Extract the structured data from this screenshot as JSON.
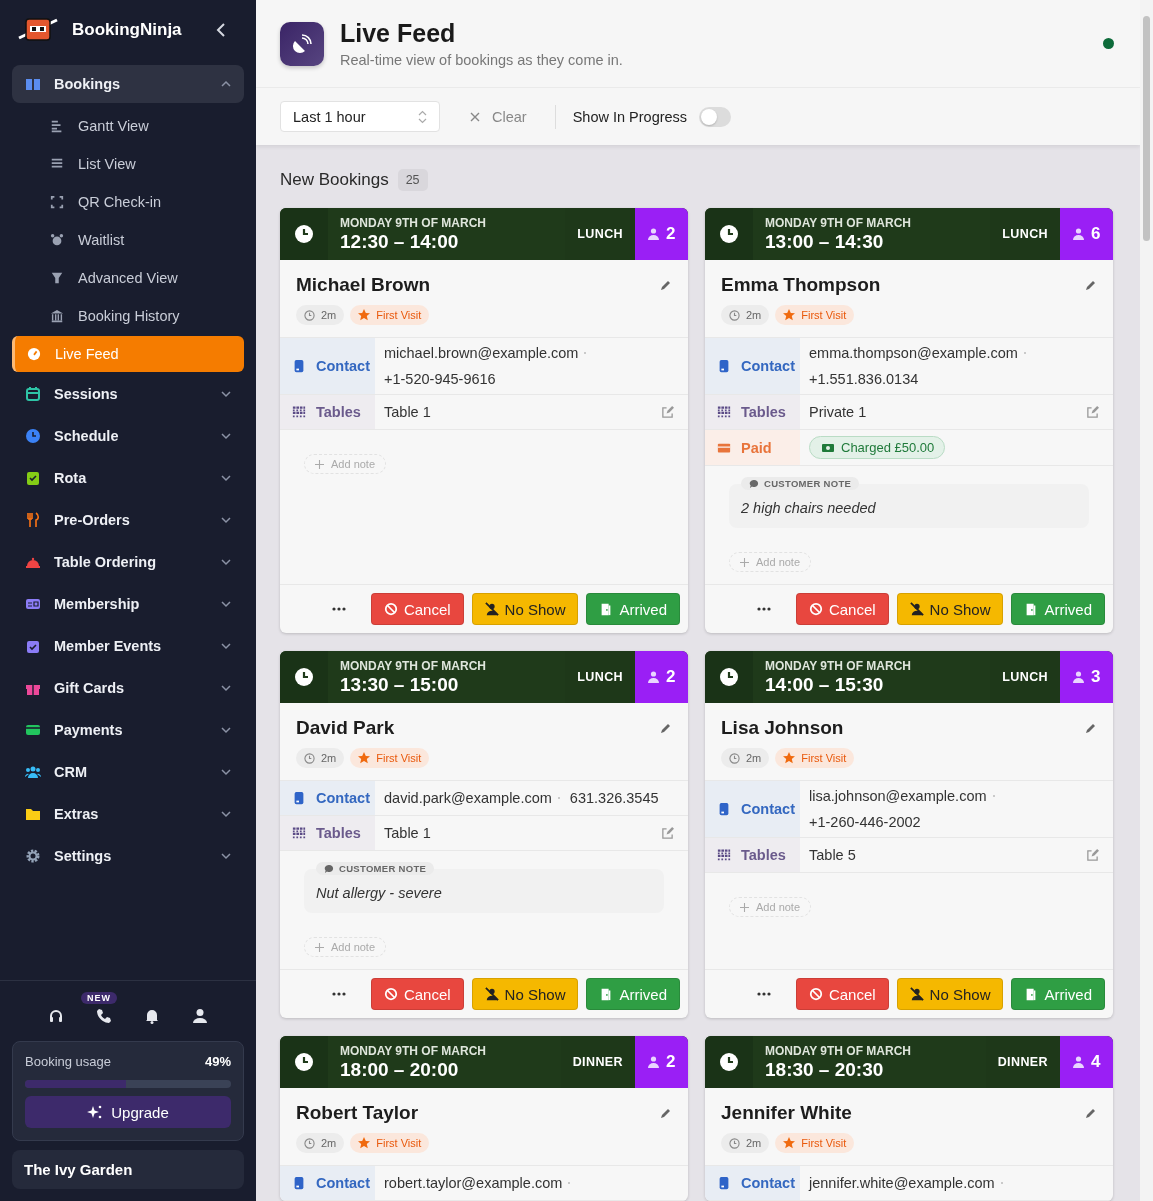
{
  "sidebar": {
    "brand": "BookingNinja",
    "nav": [
      {
        "label": "Bookings",
        "expanded": true,
        "children": [
          {
            "label": "Gantt View",
            "selected": false
          },
          {
            "label": "List View",
            "selected": false
          },
          {
            "label": "QR Check-in",
            "selected": false
          },
          {
            "label": "Waitlist",
            "selected": false
          },
          {
            "label": "Advanced View",
            "selected": false
          },
          {
            "label": "Booking History",
            "selected": false
          },
          {
            "label": "Live Feed",
            "selected": true
          }
        ]
      },
      {
        "label": "Sessions",
        "expanded": false
      },
      {
        "label": "Schedule",
        "expanded": false
      },
      {
        "label": "Rota",
        "expanded": false
      },
      {
        "label": "Pre-Orders",
        "expanded": false
      },
      {
        "label": "Table Ordering",
        "expanded": false
      },
      {
        "label": "Membership",
        "expanded": false
      },
      {
        "label": "Member Events",
        "expanded": false
      },
      {
        "label": "Gift Cards",
        "expanded": false
      },
      {
        "label": "Payments",
        "expanded": false
      },
      {
        "label": "CRM",
        "expanded": false
      },
      {
        "label": "Extras",
        "expanded": false
      },
      {
        "label": "Settings",
        "expanded": false
      }
    ],
    "new_badge": "NEW",
    "usage": {
      "label": "Booking usage",
      "value": "49%",
      "level": 0.49,
      "button": "Upgrade"
    },
    "venue": "The Ivy Garden"
  },
  "header": {
    "title": "Live Feed",
    "subtitle": "Real-time view of bookings as they come in.",
    "live": true
  },
  "filters": {
    "range": "Last 1 hour",
    "clear": "Clear",
    "show_in_progress": {
      "label": "Show In Progress",
      "on": false
    }
  },
  "section": {
    "title": "New Bookings",
    "count": "25"
  },
  "bookings": [
    {
      "date": "MONDAY 9TH OF MARCH",
      "time": "12:30 – 14:00",
      "service": "LUNCH",
      "guests": "2",
      "name": "Michael Brown",
      "age": "2m",
      "tag": "First Visit",
      "details": [
        {
          "kind": "contact",
          "label": "Contact",
          "values": [
            "michael.brown@example.com",
            "+1-520-945-9616"
          ]
        },
        {
          "kind": "tables",
          "label": "Tables",
          "values": [
            "Table 1"
          ]
        }
      ],
      "add_note": "Add note",
      "actions": [
        {
          "kind": "cancel",
          "label": "Cancel"
        },
        {
          "kind": "no_show",
          "label": "No Show"
        },
        {
          "kind": "arrived",
          "label": "Arrived"
        }
      ]
    },
    {
      "date": "MONDAY 9TH OF MARCH",
      "time": "13:00 – 14:30",
      "service": "LUNCH",
      "guests": "6",
      "name": "Emma Thompson",
      "age": "2m",
      "tag": "First Visit",
      "details": [
        {
          "kind": "contact",
          "label": "Contact",
          "values": [
            "emma.thompson@example.com",
            "+1.551.836.0134"
          ]
        },
        {
          "kind": "tables",
          "label": "Tables",
          "values": [
            "Private 1"
          ]
        },
        {
          "kind": "payment",
          "label": "Paid",
          "values": [
            "Charged £50.00"
          ]
        }
      ],
      "note": {
        "label": "CUSTOMER NOTE",
        "text": "2 high chairs needed"
      },
      "add_note": "Add note",
      "actions": [
        {
          "kind": "cancel",
          "label": "Cancel"
        },
        {
          "kind": "no_show",
          "label": "No Show"
        },
        {
          "kind": "arrived",
          "label": "Arrived"
        }
      ]
    },
    {
      "date": "MONDAY 9TH OF MARCH",
      "time": "13:30 – 15:00",
      "service": "LUNCH",
      "guests": "2",
      "name": "David Park",
      "age": "2m",
      "tag": "First Visit",
      "details": [
        {
          "kind": "contact",
          "label": "Contact",
          "values": [
            "david.park@example.com",
            "631.326.3545"
          ]
        },
        {
          "kind": "tables",
          "label": "Tables",
          "values": [
            "Table 1"
          ]
        }
      ],
      "note": {
        "label": "CUSTOMER NOTE",
        "text": "Nut allergy - severe"
      },
      "add_note": "Add note",
      "actions": [
        {
          "kind": "cancel",
          "label": "Cancel"
        },
        {
          "kind": "no_show",
          "label": "No Show"
        },
        {
          "kind": "arrived",
          "label": "Arrived"
        }
      ]
    },
    {
      "date": "MONDAY 9TH OF MARCH",
      "time": "14:00 – 15:30",
      "service": "LUNCH",
      "guests": "3",
      "name": "Lisa Johnson",
      "age": "2m",
      "tag": "First Visit",
      "details": [
        {
          "kind": "contact",
          "label": "Contact",
          "values": [
            "lisa.johnson@example.com",
            "+1-260-446-2002"
          ]
        },
        {
          "kind": "tables",
          "label": "Tables",
          "values": [
            "Table 5"
          ]
        }
      ],
      "add_note": "Add note",
      "actions": [
        {
          "kind": "cancel",
          "label": "Cancel"
        },
        {
          "kind": "no_show",
          "label": "No Show"
        },
        {
          "kind": "arrived",
          "label": "Arrived"
        }
      ]
    },
    {
      "date": "MONDAY 9TH OF MARCH",
      "time": "18:00 – 20:00",
      "service": "DINNER",
      "guests": "2",
      "name": "Robert Taylor",
      "age": "2m",
      "tag": "First Visit",
      "details": [
        {
          "kind": "contact",
          "label": "Contact",
          "values": [
            "robert.taylor@example.com"
          ]
        }
      ]
    },
    {
      "date": "MONDAY 9TH OF MARCH",
      "time": "18:30 – 20:30",
      "service": "DINNER",
      "guests": "4",
      "name": "Jennifer White",
      "age": "2m",
      "tag": "First Visit",
      "details": [
        {
          "kind": "contact",
          "label": "Contact",
          "values": [
            "jennifer.white@example.com"
          ]
        }
      ]
    }
  ]
}
